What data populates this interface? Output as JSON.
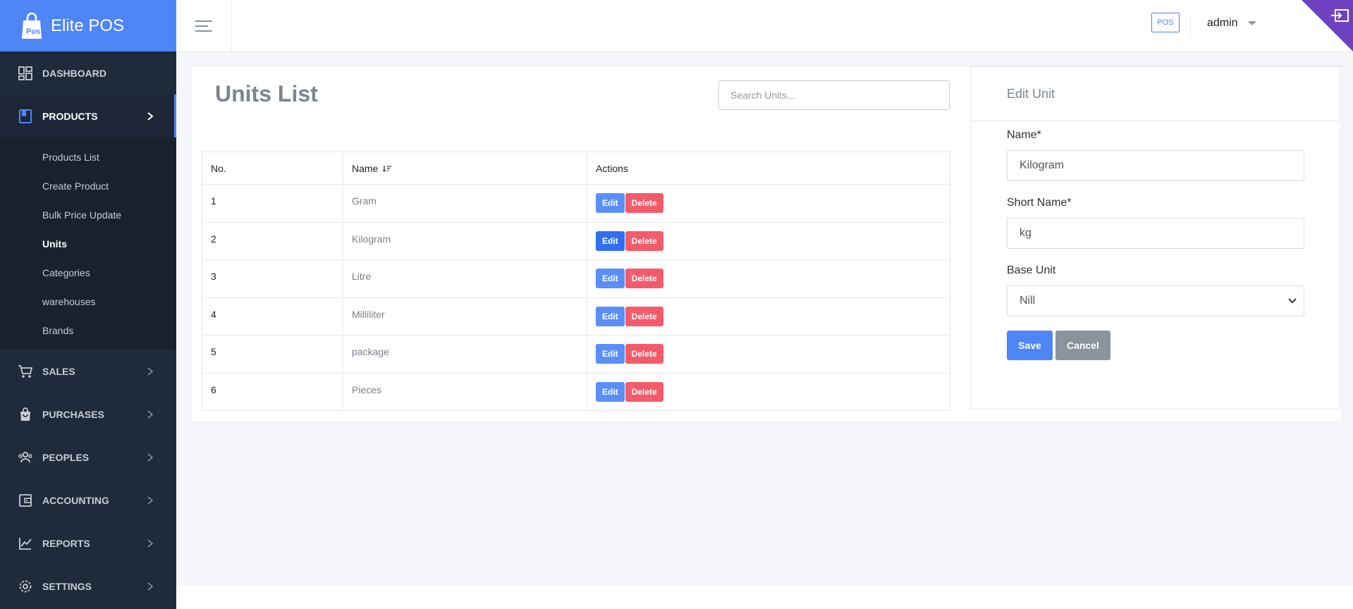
{
  "brand": {
    "name": "Elite POS"
  },
  "sidebar": {
    "items": [
      {
        "label": "DASHBOARD"
      },
      {
        "label": "PRODUCTS"
      },
      {
        "label": "SALES"
      },
      {
        "label": "PURCHASES"
      },
      {
        "label": "PEOPLES"
      },
      {
        "label": "ACCOUNTING"
      },
      {
        "label": "REPORTS"
      },
      {
        "label": "SETTINGS"
      }
    ],
    "products_sub": [
      {
        "label": "Products List"
      },
      {
        "label": "Create Product"
      },
      {
        "label": "Bulk Price Update"
      },
      {
        "label": "Units"
      },
      {
        "label": "Categories"
      },
      {
        "label": "warehouses"
      },
      {
        "label": "Brands"
      }
    ]
  },
  "header": {
    "pos_label": "POS",
    "user": "admin"
  },
  "units": {
    "title": "Units List",
    "search_placeholder": "Search Units...",
    "columns": {
      "no": "No.",
      "name": "Name",
      "actions": "Actions"
    },
    "edit_label": "Edit",
    "delete_label": "Delete",
    "rows": [
      {
        "no": "1",
        "name": "Gram"
      },
      {
        "no": "2",
        "name": "Kilogram"
      },
      {
        "no": "3",
        "name": "Litre"
      },
      {
        "no": "4",
        "name": "Milliliter"
      },
      {
        "no": "5",
        "name": "package"
      },
      {
        "no": "6",
        "name": "Pieces"
      }
    ]
  },
  "edit_unit": {
    "title": "Edit Unit",
    "name_label": "Name*",
    "name_value": "Kilogram",
    "short_label": "Short Name*",
    "short_value": "kg",
    "base_label": "Base Unit",
    "base_value": "Nill",
    "save": "Save",
    "cancel": "Cancel"
  },
  "colors": {
    "primary": "#4e85f7",
    "danger": "#f45b6a",
    "sidebar": "#1f2a3a",
    "accent_corner": "#6f42c1"
  }
}
